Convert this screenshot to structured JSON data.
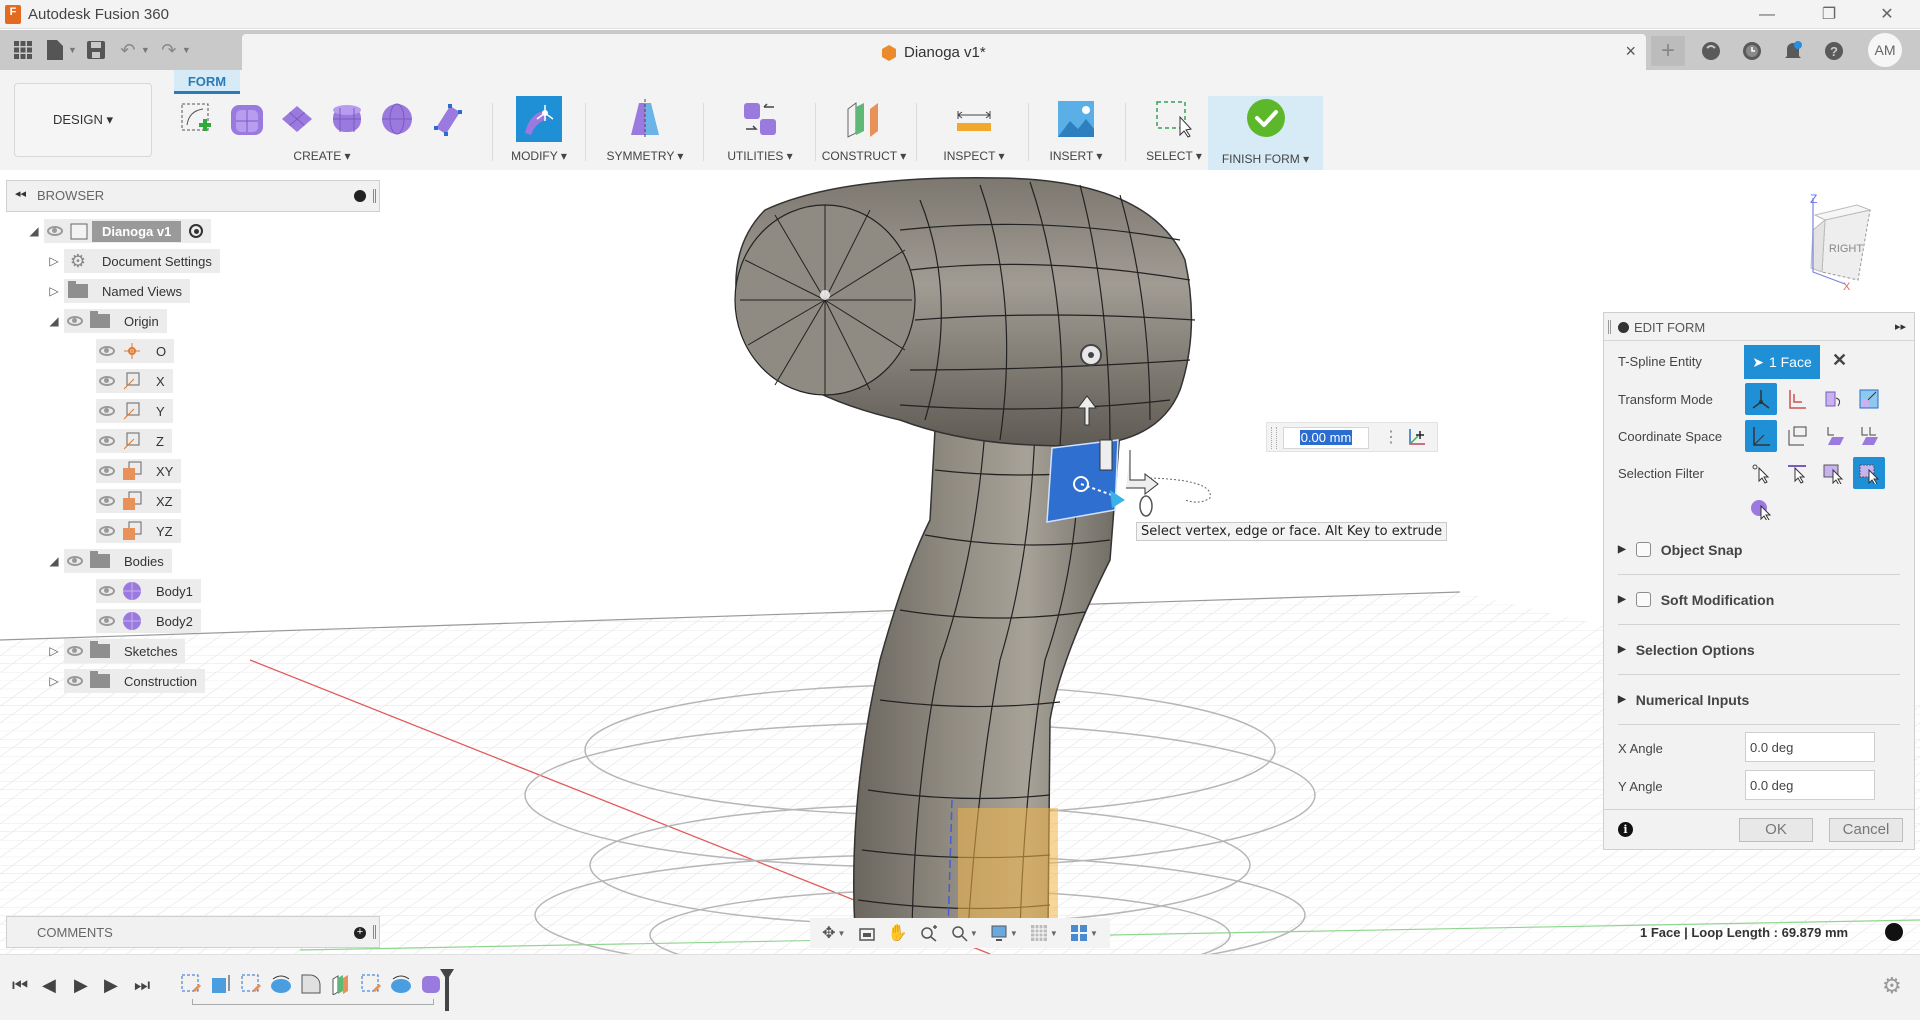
{
  "app": {
    "title": "Autodesk Fusion 360",
    "window_controls": [
      "minimize",
      "restore",
      "close"
    ]
  },
  "tabbar": {
    "quick_access": [
      "apps-grid-icon",
      "file-icon",
      "save-icon",
      "undo-icon",
      "redo-icon"
    ],
    "document_tab": "Dianoga v1*",
    "close_glyph": "×",
    "right_icons": [
      "new-tab-icon",
      "extensions-icon",
      "job-status-icon",
      "notifications-icon",
      "help-icon"
    ],
    "user_initials": "AM"
  },
  "ribbon": {
    "workspace": "DESIGN ▾",
    "active_tab": "FORM",
    "groups": [
      {
        "label": "CREATE ▾"
      },
      {
        "label": "MODIFY ▾"
      },
      {
        "label": "SYMMETRY ▾"
      },
      {
        "label": "UTILITIES ▾"
      },
      {
        "label": "CONSTRUCT ▾"
      },
      {
        "label": "INSPECT ▾"
      },
      {
        "label": "INSERT ▾"
      },
      {
        "label": "SELECT ▾"
      },
      {
        "label": "FINISH FORM ▾"
      }
    ]
  },
  "browser": {
    "title": "BROWSER",
    "tree": [
      {
        "label": "Dianoga v1",
        "level": 0,
        "expanded": true
      },
      {
        "label": "Document Settings",
        "level": 1,
        "expanded": false
      },
      {
        "label": "Named Views",
        "level": 1,
        "expanded": false
      },
      {
        "label": "Origin",
        "level": 1,
        "expanded": true
      },
      {
        "label": "O",
        "level": 2
      },
      {
        "label": "X",
        "level": 2
      },
      {
        "label": "Y",
        "level": 2
      },
      {
        "label": "Z",
        "level": 2
      },
      {
        "label": "XY",
        "level": 2
      },
      {
        "label": "XZ",
        "level": 2
      },
      {
        "label": "YZ",
        "level": 2
      },
      {
        "label": "Bodies",
        "level": 1,
        "expanded": true
      },
      {
        "label": "Body1",
        "level": 2
      },
      {
        "label": "Body2",
        "level": 2
      },
      {
        "label": "Sketches",
        "level": 1,
        "expanded": false
      },
      {
        "label": "Construction",
        "level": 1,
        "expanded": false
      }
    ]
  },
  "comments": {
    "title": "COMMENTS"
  },
  "viewcube": {
    "face_label": "RIGHT",
    "axis_z": "Z",
    "axis_x": "X"
  },
  "manipulator": {
    "distance_value": "0.00 mm"
  },
  "tooltip": "Select vertex, edge or face. Alt Key to extrude",
  "edit_form": {
    "title": "EDIT FORM",
    "tspline_entity_label": "T-Spline Entity",
    "tspline_entity_value": "1 Face",
    "transform_mode_label": "Transform Mode",
    "coordinate_space_label": "Coordinate Space",
    "selection_filter_label": "Selection Filter",
    "sections": [
      {
        "label": "Object Snap",
        "checkbox": true,
        "checked": false
      },
      {
        "label": "Soft Modification",
        "checkbox": true,
        "checked": false
      },
      {
        "label": "Selection Options",
        "checkbox": false
      },
      {
        "label": "Numerical Inputs",
        "checkbox": false
      }
    ],
    "x_angle_label": "X Angle",
    "x_angle_value": "0.0 deg",
    "y_angle_label": "Y Angle",
    "y_angle_value": "0.0 deg",
    "ok_label": "OK",
    "cancel_label": "Cancel"
  },
  "status": {
    "selection_info": "1 Face | Loop Length : 69.879 mm"
  },
  "colors": {
    "accent": "#1f8fd6",
    "selected_face": "#2f6fcf",
    "finish_green": "#5cb82a",
    "form_purple": "#9b7ae0"
  }
}
